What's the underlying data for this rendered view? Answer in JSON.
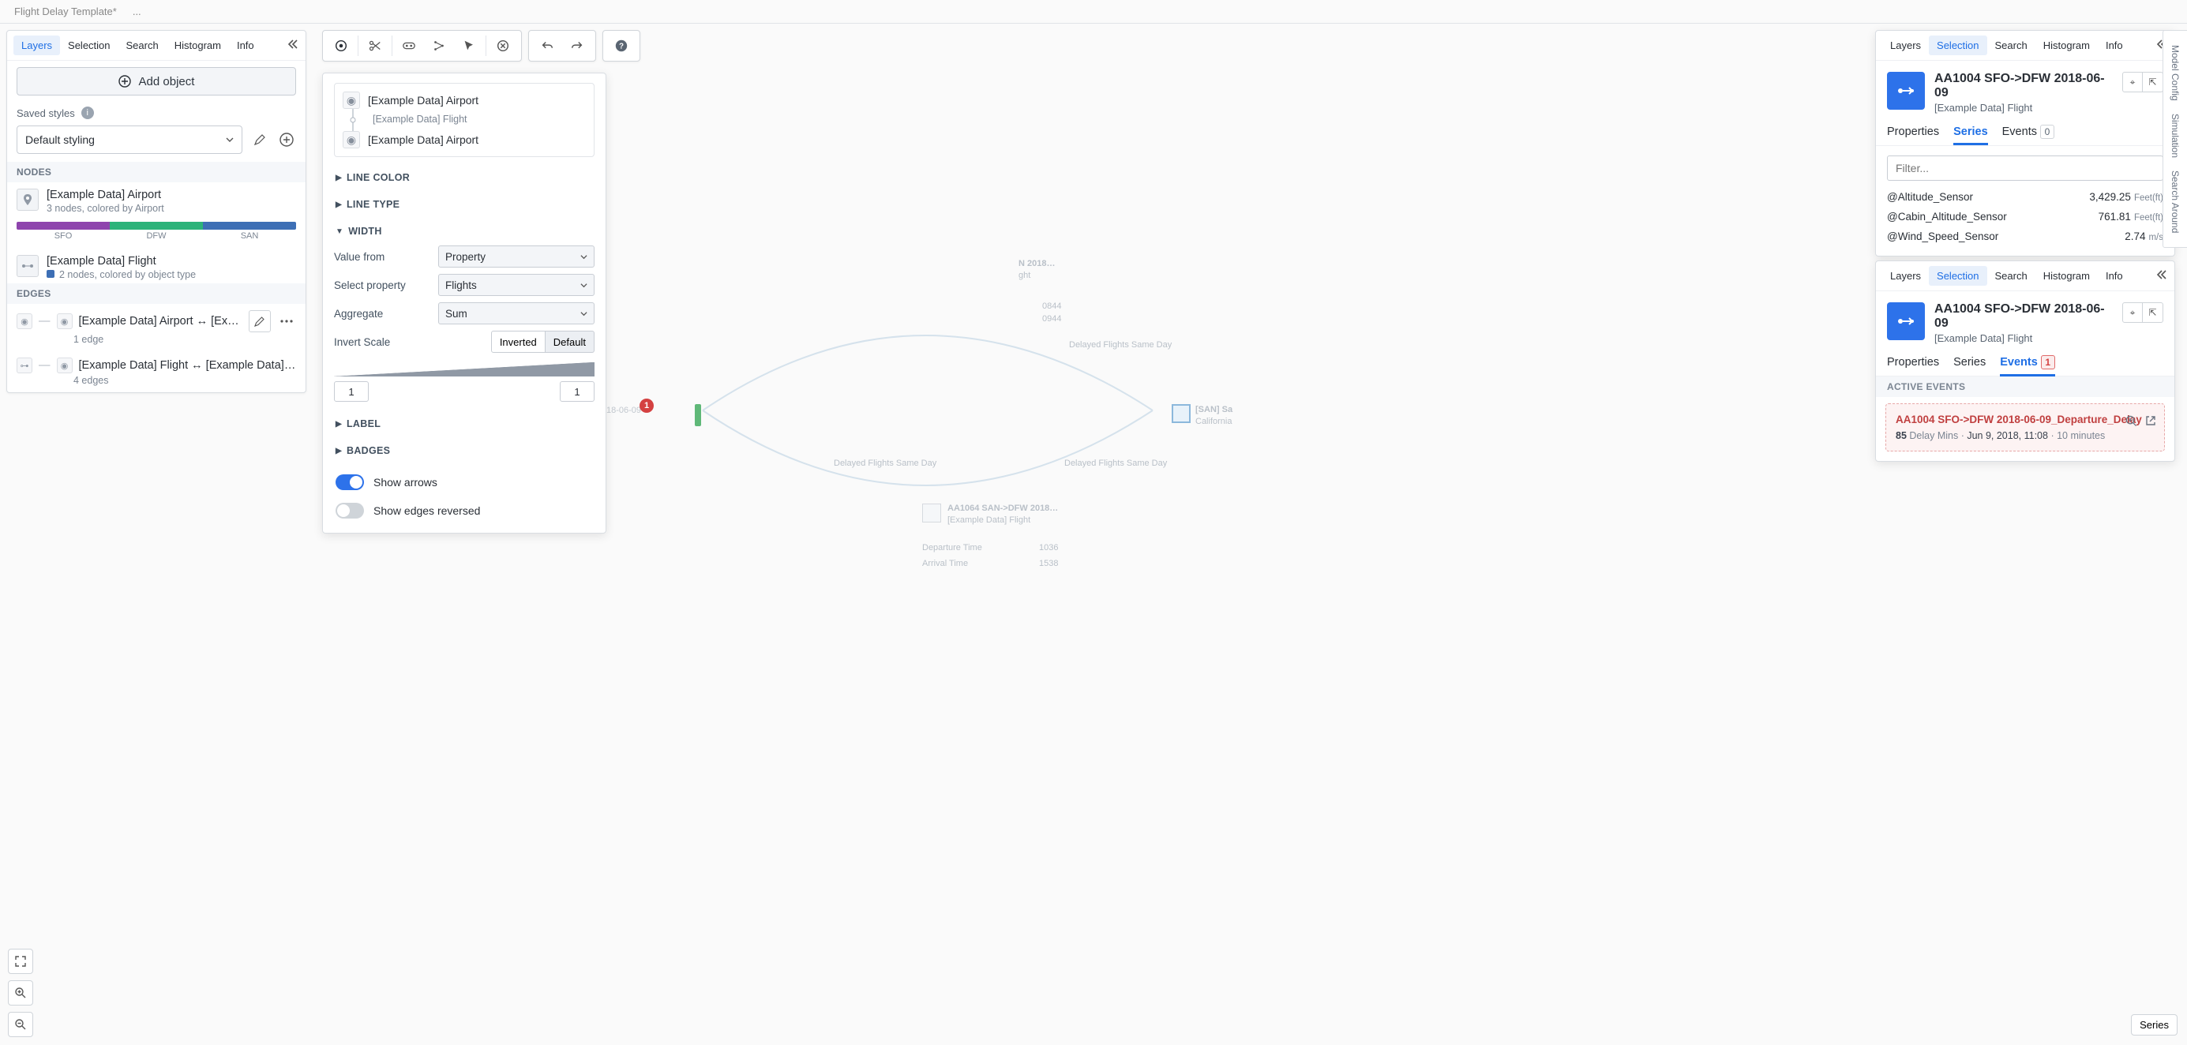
{
  "topbar": {
    "tab": "Flight Delay Template*",
    "more": "..."
  },
  "left": {
    "tabs": [
      "Layers",
      "Selection",
      "Search",
      "Histogram",
      "Info"
    ],
    "activeTab": "Layers",
    "add_object_label": "Add object",
    "saved_styles_label": "Saved styles",
    "style_dropdown": "Default styling",
    "nodes_header": "NODES",
    "edges_header": "EDGES",
    "nodes": [
      {
        "title": "[Example Data] Airport",
        "sub": "3 nodes, colored by Airport",
        "colors": [
          "SFO",
          "DFW",
          "SAN"
        ]
      },
      {
        "title": "[Example Data] Flight",
        "sub": "2 nodes, colored by object type"
      }
    ],
    "edges": [
      {
        "title": "[Example Data] Airport ↔ [Exam…",
        "sub": "1 edge"
      },
      {
        "title": "[Example Data] Flight ↔ [Example Data] Air…",
        "sub": "4 edges"
      }
    ]
  },
  "config": {
    "relation_from": "[Example Data] Airport",
    "relation_mid": "[Example Data] Flight",
    "relation_to": "[Example Data] Airport",
    "sections": {
      "line_color": "LINE COLOR",
      "line_type": "LINE TYPE",
      "width": "WIDTH",
      "label": "LABEL",
      "badges": "BADGES"
    },
    "width": {
      "value_from_label": "Value from",
      "value_from": "Property",
      "select_property_label": "Select property",
      "select_property": "Flights",
      "aggregate_label": "Aggregate",
      "aggregate": "Sum",
      "invert_scale_label": "Invert Scale",
      "inverted": "Inverted",
      "default": "Default",
      "min": "1",
      "max": "1"
    },
    "show_arrows": "Show arrows",
    "show_edges_reversed": "Show edges reversed"
  },
  "sel_top": {
    "tabs": [
      "Layers",
      "Selection",
      "Search",
      "Histogram",
      "Info"
    ],
    "activeTab": "Selection",
    "title": "AA1004 SFO->DFW 2018-06-09",
    "sub": "[Example Data] Flight",
    "detail_tabs": [
      "Properties",
      "Series",
      "Events"
    ],
    "detail_active": "Series",
    "events_count": "0",
    "filter_placeholder": "Filter...",
    "series": [
      {
        "name": "@Altitude_Sensor",
        "value": "3,429.25",
        "unit": "Feet(ft)"
      },
      {
        "name": "@Cabin_Altitude_Sensor",
        "value": "761.81",
        "unit": "Feet(ft)"
      },
      {
        "name": "@Wind_Speed_Sensor",
        "value": "2.74",
        "unit": "m/s"
      }
    ]
  },
  "sel_bottom": {
    "tabs": [
      "Layers",
      "Selection",
      "Search",
      "Histogram",
      "Info"
    ],
    "activeTab": "Selection",
    "title": "AA1004 SFO->DFW 2018-06-09",
    "sub": "[Example Data] Flight",
    "detail_tabs": [
      "Properties",
      "Series",
      "Events"
    ],
    "detail_active": "Events",
    "events_count": "1",
    "active_events_header": "ACTIVE EVENTS",
    "event_title": "AA1004 SFO->DFW 2018-06-09_Departure_Delay",
    "event_value": "85",
    "event_value_unit": "Delay Mins",
    "event_date": "Jun 9, 2018, 11:08",
    "event_duration": "10 minutes"
  },
  "rail": {
    "items": [
      "Model Config",
      "Simulation",
      "Search Around"
    ]
  },
  "br_button": "Series",
  "graph": {
    "center_label": "18-06-09",
    "badge": "1",
    "ghost_n": "N 2018…",
    "ghost_n_sub": "ght",
    "ghost_dates": [
      "0844",
      "0944"
    ],
    "ghost_delayed1": "Delayed Flights Same Day",
    "ghost_delayed2": "Delayed Flights Same Day",
    "ghost_delayed3": "Delayed Flights Same Day",
    "san_label": "[SAN] Sa",
    "san_sub": "California",
    "aa1064_title": "AA1064 SAN->DFW 2018…",
    "aa1064_sub": "[Example Data] Flight",
    "dep_time_label": "Departure Time",
    "dep_time_val": "1036",
    "arr_time_label": "Arrival Time",
    "arr_time_val": "1538"
  }
}
